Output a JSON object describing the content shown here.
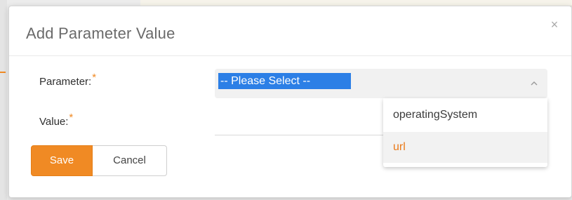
{
  "dialog": {
    "title": "Add Parameter Value",
    "close_symbol": "×"
  },
  "form": {
    "parameter_label": "Parameter:",
    "value_label": "Value:",
    "required_marker": "*",
    "parameter_select": {
      "selected": "-- Please Select --",
      "expanded": true,
      "options": [
        "operatingSystem",
        "url"
      ],
      "hovered_option": "url"
    },
    "value_input": {
      "value": "",
      "placeholder": ""
    }
  },
  "buttons": {
    "save_label": "Save",
    "cancel_label": "Cancel"
  },
  "colors": {
    "accent": "#f08a24",
    "selection": "#2c7fe6",
    "hover_text": "#ea7a1a"
  },
  "icons": {
    "close": "close-icon",
    "chevron": "chevron-up-icon"
  }
}
